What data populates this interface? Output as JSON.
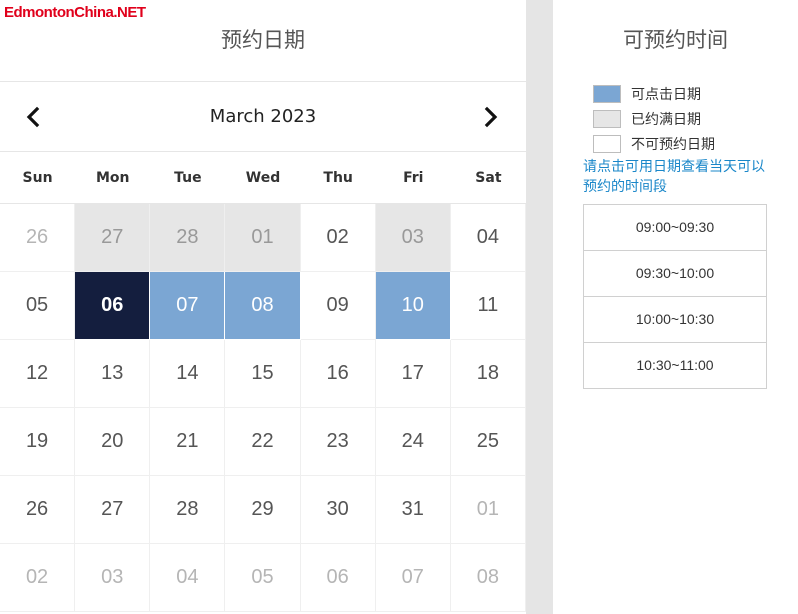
{
  "logo": {
    "text": "EdmontonChina.NET"
  },
  "calendar": {
    "title": "预约日期",
    "month_label": "March 2023",
    "prev_icon": "chevron-left-icon",
    "next_icon": "chevron-right-icon",
    "weekdays": [
      "Sun",
      "Mon",
      "Tue",
      "Wed",
      "Thu",
      "Fri",
      "Sat"
    ],
    "weeks": [
      [
        {
          "day": "26",
          "state": "other"
        },
        {
          "day": "27",
          "state": "booked"
        },
        {
          "day": "28",
          "state": "booked"
        },
        {
          "day": "01",
          "state": "booked"
        },
        {
          "day": "02",
          "state": "unavailable"
        },
        {
          "day": "03",
          "state": "booked"
        },
        {
          "day": "04",
          "state": "unavailable"
        }
      ],
      [
        {
          "day": "05",
          "state": "unavailable"
        },
        {
          "day": "06",
          "state": "selected"
        },
        {
          "day": "07",
          "state": "available"
        },
        {
          "day": "08",
          "state": "available"
        },
        {
          "day": "09",
          "state": "unavailable"
        },
        {
          "day": "10",
          "state": "available"
        },
        {
          "day": "11",
          "state": "unavailable"
        }
      ],
      [
        {
          "day": "12",
          "state": "unavailable"
        },
        {
          "day": "13",
          "state": "unavailable"
        },
        {
          "day": "14",
          "state": "unavailable"
        },
        {
          "day": "15",
          "state": "unavailable"
        },
        {
          "day": "16",
          "state": "unavailable"
        },
        {
          "day": "17",
          "state": "unavailable"
        },
        {
          "day": "18",
          "state": "unavailable"
        }
      ],
      [
        {
          "day": "19",
          "state": "unavailable"
        },
        {
          "day": "20",
          "state": "unavailable"
        },
        {
          "day": "21",
          "state": "unavailable"
        },
        {
          "day": "22",
          "state": "unavailable"
        },
        {
          "day": "23",
          "state": "unavailable"
        },
        {
          "day": "24",
          "state": "unavailable"
        },
        {
          "day": "25",
          "state": "unavailable"
        }
      ],
      [
        {
          "day": "26",
          "state": "unavailable"
        },
        {
          "day": "27",
          "state": "unavailable"
        },
        {
          "day": "28",
          "state": "unavailable"
        },
        {
          "day": "29",
          "state": "unavailable"
        },
        {
          "day": "30",
          "state": "unavailable"
        },
        {
          "day": "31",
          "state": "unavailable"
        },
        {
          "day": "01",
          "state": "other"
        }
      ],
      [
        {
          "day": "02",
          "state": "other"
        },
        {
          "day": "03",
          "state": "other"
        },
        {
          "day": "04",
          "state": "other"
        },
        {
          "day": "05",
          "state": "other"
        },
        {
          "day": "06",
          "state": "other"
        },
        {
          "day": "07",
          "state": "other"
        },
        {
          "day": "08",
          "state": "other"
        }
      ]
    ]
  },
  "time_panel": {
    "title": "可预约时间",
    "legend": [
      {
        "label": "可点击日期",
        "swatch": "blue"
      },
      {
        "label": "已约满日期",
        "swatch": "gray"
      },
      {
        "label": "不可预约日期",
        "swatch": "white"
      }
    ],
    "hint": "请点击可用日期查看当天可以预约的时间段",
    "slots": [
      "09:00~09:30",
      "09:30~10:00",
      "10:00~10:30",
      "10:30~11:00"
    ]
  },
  "colors": {
    "available": "#7ba6d3",
    "selected": "#141e3e",
    "booked": "#e6e6e6",
    "hint": "#1a87c9",
    "logo": "#e0001b"
  }
}
